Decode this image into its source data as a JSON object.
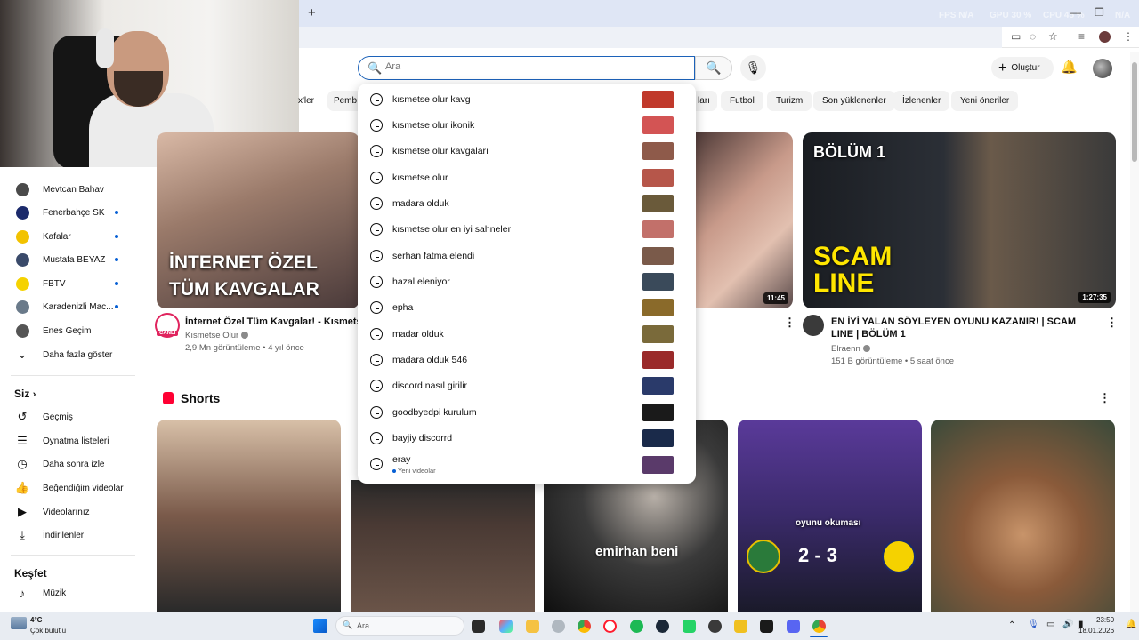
{
  "browser": {
    "new_tab": "+",
    "overlay_stats": [
      "FPS N/A",
      "GPU 30 %",
      "CPU 45 %",
      "N/A"
    ]
  },
  "search": {
    "placeholder": "Ara"
  },
  "header": {
    "create_label": "Oluştur"
  },
  "chips": [
    "x'ler",
    "Pemb",
    "ları",
    "Futbol",
    "Turizm",
    "Son yüklenenler",
    "İzlenenler",
    "Yeni öneriler"
  ],
  "sidebar": {
    "subscriptions": [
      {
        "label": "Mevtcan Bahav",
        "color": "#4a4a4a",
        "new": false
      },
      {
        "label": "Fenerbahçe SK",
        "color": "#1b2a6b",
        "new": true
      },
      {
        "label": "Kafalar",
        "color": "#f2c200",
        "new": true
      },
      {
        "label": "Mustafa BEYAZ",
        "color": "#3a4a6a",
        "new": true
      },
      {
        "label": "FBTV",
        "color": "#f5d200",
        "new": true
      },
      {
        "label": "Karadenizli Mac...",
        "color": "#6a7a8a",
        "new": true
      },
      {
        "label": "Enes Geçim",
        "color": "#555555",
        "new": false
      }
    ],
    "show_more": "Daha fazla göster",
    "you_heading": "Siz",
    "you_items": [
      {
        "label": "Geçmiş",
        "icon": "history-icon",
        "glyph": "↺"
      },
      {
        "label": "Oynatma listeleri",
        "icon": "playlist-icon",
        "glyph": "☰"
      },
      {
        "label": "Daha sonra izle",
        "icon": "clock-icon",
        "glyph": "◷"
      },
      {
        "label": "Beğendiğim videolar",
        "icon": "thumbs-up-icon",
        "glyph": "👍"
      },
      {
        "label": "Videolarınız",
        "icon": "video-icon",
        "glyph": "▶"
      },
      {
        "label": "İndirilenler",
        "icon": "download-icon",
        "glyph": "⤓"
      }
    ],
    "explore_heading": "Keşfet",
    "explore_items": [
      {
        "label": "Müzik",
        "icon": "music-icon",
        "glyph": "♪"
      }
    ]
  },
  "suggestions": [
    {
      "text": "kısmetse olur kavg",
      "thumb": "#c0392b"
    },
    {
      "text": "kısmetse olur ikonik",
      "thumb": "#d35454"
    },
    {
      "text": "kısmetse olur kavgaları",
      "thumb": "#8e5a4a"
    },
    {
      "text": "kısmetse olur",
      "thumb": "#b6564a"
    },
    {
      "text": "madara olduk",
      "thumb": "#6a5a3a"
    },
    {
      "text": "kısmetse olur en iyi sahneler",
      "thumb": "#c2706a"
    },
    {
      "text": "serhan fatma elendi",
      "thumb": "#7a5a4a"
    },
    {
      "text": "hazal eleniyor",
      "thumb": "#3a4a5a"
    },
    {
      "text": "epha",
      "thumb": "#8a6a2a"
    },
    {
      "text": "madar olduk",
      "thumb": "#7a6a3a"
    },
    {
      "text": "madara olduk 546",
      "thumb": "#9a2a2a"
    },
    {
      "text": "discord nasıl girilir",
      "thumb": "#2a3a6a"
    },
    {
      "text": "goodbyedpi kurulum",
      "thumb": "#1a1a1a"
    },
    {
      "text": "bayjiy discorrd",
      "thumb": "#1a2a4a"
    },
    {
      "text": "eray",
      "thumb": "#5a3a6a",
      "sub": "Yeni videolar"
    }
  ],
  "videos": [
    {
      "thumb_text": "İNTERNET ÖZEL TÜM KAVGALAR",
      "title": "İnternet Özel Tüm Kavgalar! - Kısmetse O",
      "channel": "Kısmetse Olur",
      "meta": "2,9 Mn görüntüleme • 4 yıl önce",
      "badge": "CANLI"
    },
    {
      "duration": "11:45"
    },
    {
      "thumb_text_1": "BÖLÜM 1",
      "thumb_text_2": "SCAM LINE",
      "duration": "1:27:35",
      "title": "EN İYİ YALAN SÖYLEYEN OYUNU KAZANIR! | SCAM LINE | BÖLÜM 1",
      "channel": "Elraenn",
      "meta": "151 B görüntüleme • 5 saat önce"
    }
  ],
  "shorts": {
    "heading": "Shorts",
    "items": [
      {
        "caption": ""
      },
      {
        "caption": ""
      },
      {
        "caption": "emirhan beni"
      },
      {
        "caption": "oyunu okuması",
        "score": "2 - 3"
      },
      {
        "caption": ""
      }
    ]
  },
  "taskbar": {
    "weather_temp": "4°C",
    "weather_desc": "Çok bulutlu",
    "search": "Ara",
    "time": "23:50",
    "date": "18.01.2026"
  },
  "colors": {
    "accent": "#065fd4",
    "search_border": "#1c62b9",
    "shorts_red": "#ff0033"
  }
}
